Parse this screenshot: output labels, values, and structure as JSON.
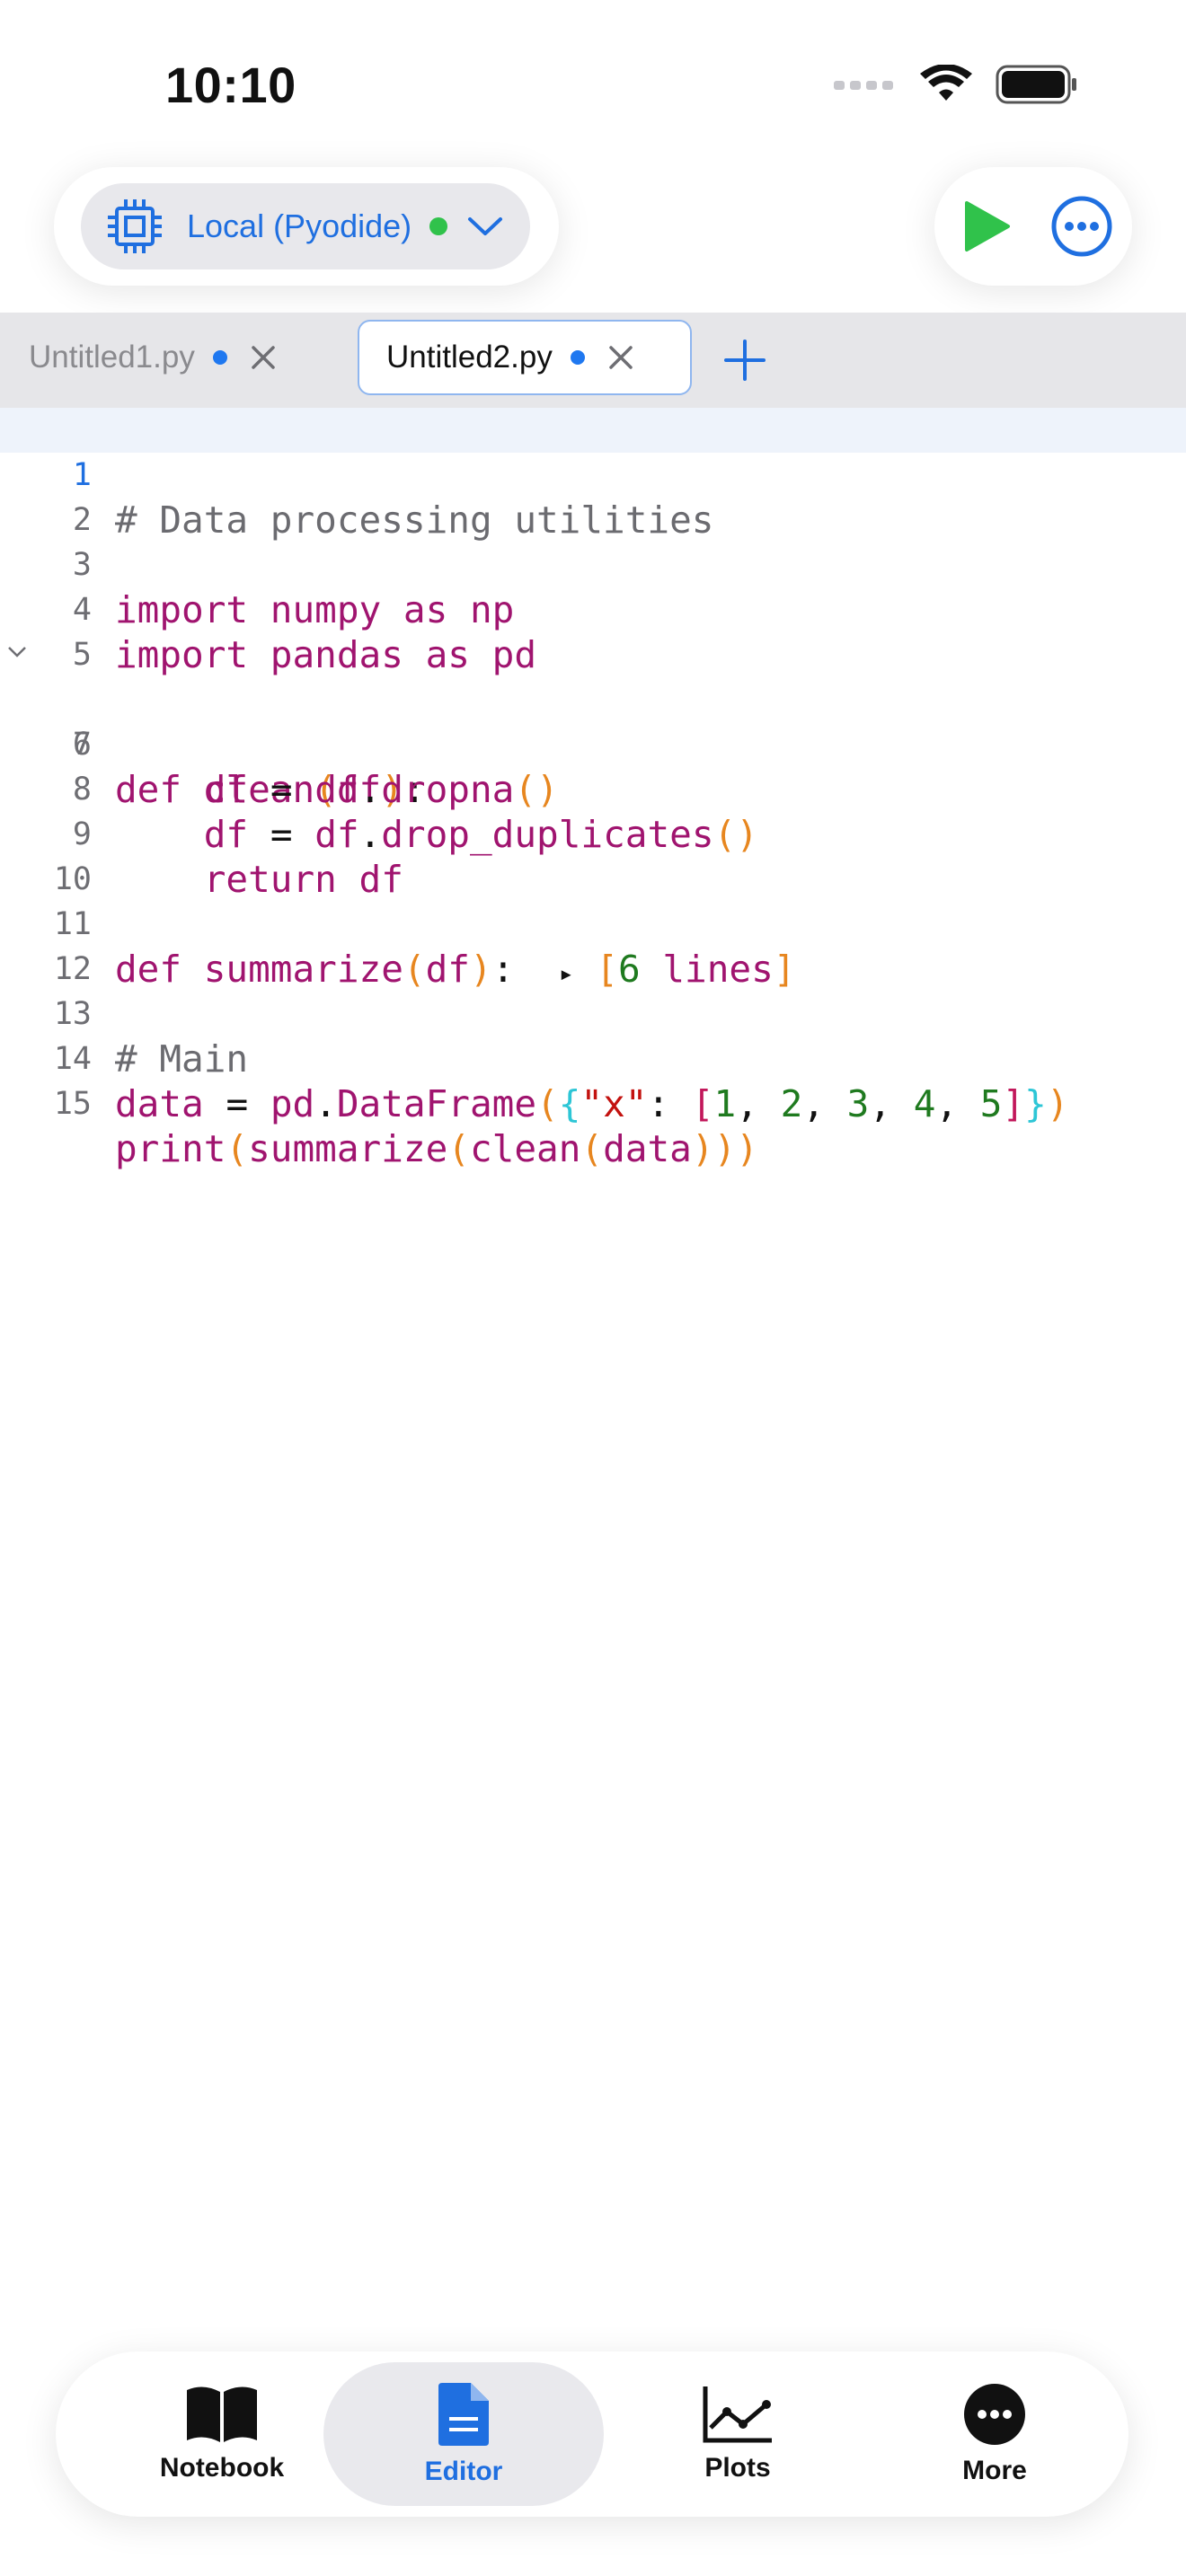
{
  "status_bar": {
    "time": "10:10"
  },
  "kernel": {
    "label": "Local (Pyodide)",
    "status_color": "#30c24b"
  },
  "tabs": [
    {
      "label": "Untitled1.py",
      "active": false
    },
    {
      "label": "Untitled2.py",
      "active": true
    }
  ],
  "editor": {
    "current_line": 1,
    "lines": [
      {
        "no": "1",
        "text": "# Data processing utilities"
      },
      {
        "no": "2",
        "text": ""
      },
      {
        "no": "3",
        "text": "import numpy as np"
      },
      {
        "no": "4",
        "text": "import pandas as pd"
      },
      {
        "no": "5",
        "text": ""
      },
      {
        "no": "6",
        "text": "def clean(df):"
      },
      {
        "no": "7",
        "text": "    df = df.dropna()"
      },
      {
        "no": "8",
        "text": "    df = df.drop_duplicates()"
      },
      {
        "no": "9",
        "text": "    return df"
      },
      {
        "no": "10",
        "text": ""
      },
      {
        "no": "11",
        "text": "def summarize(df):  ▸ [6 lines]"
      },
      {
        "no": "12",
        "text": ""
      },
      {
        "no": "13",
        "text": "# Main"
      },
      {
        "no": "14",
        "text": "data = pd.DataFrame({\"x\": [1, 2, 3, 4, 5]})"
      },
      {
        "no": "15",
        "text": "print(summarize(clean(data)))"
      }
    ]
  },
  "nav": {
    "notebook": "Notebook",
    "editor": "Editor",
    "plots": "Plots",
    "more": "More",
    "active": "Editor"
  },
  "colors": {
    "accent": "#1f6fe0",
    "run": "#30c24b"
  }
}
